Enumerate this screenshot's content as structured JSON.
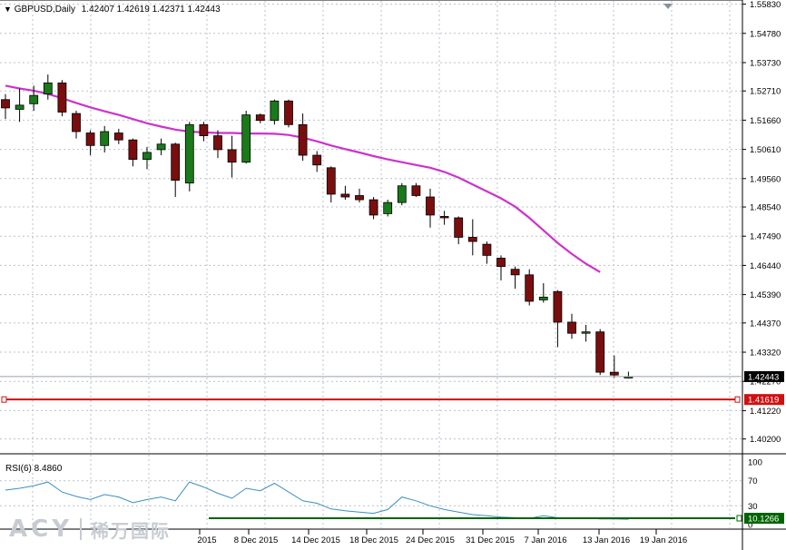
{
  "header": {
    "symbol": "GBPUSD,Daily",
    "ohlc": "1.42407 1.42619 1.42371 1.42443"
  },
  "price_axis": {
    "labels": [
      "1.55830",
      "1.54780",
      "1.53730",
      "1.52710",
      "1.51660",
      "1.50610",
      "1.49560",
      "1.48540",
      "1.47490",
      "1.46440",
      "1.45390",
      "1.44370",
      "1.43320",
      "1.42270",
      "1.41220",
      "1.40200"
    ],
    "bid_label": "1.42443",
    "level_label": "1.41619"
  },
  "date_axis": {
    "labels": [
      "2015",
      "8 Dec 2015",
      "14 Dec 2015",
      "18 Dec 2015",
      "24 Dec 2015",
      "31 Dec 2015",
      "7 Jan 2016",
      "13 Jan 2016",
      "19 Jan 2016"
    ]
  },
  "rsi": {
    "title": "RSI(6) 8.4860",
    "levels": [
      "100",
      "70",
      "30",
      "0"
    ],
    "value_label": "10.1266"
  },
  "watermark": {
    "brand": "ACY",
    "chinese": "稀万国际"
  },
  "colors": {
    "bull": "#1a7a1a",
    "bear": "#7a0e0e",
    "ma": "#cc33cc",
    "rsi_line": "#3a8fc0",
    "level_line": "#d01010",
    "rsi_value_line": "#006400",
    "grid": "#b8c0cc"
  },
  "chart_data": {
    "type": "candlestick",
    "symbol": "GBPUSD",
    "timeframe": "Daily",
    "price_range": [
      1.397,
      1.5598
    ],
    "horizontal_level": 1.41619,
    "current_price": 1.42443,
    "candles": [
      {
        "o": 1.524,
        "h": 1.526,
        "l": 1.517,
        "c": 1.521
      },
      {
        "o": 1.5205,
        "h": 1.528,
        "l": 1.516,
        "c": 1.522
      },
      {
        "o": 1.5225,
        "h": 1.529,
        "l": 1.52,
        "c": 1.5255
      },
      {
        "o": 1.526,
        "h": 1.533,
        "l": 1.524,
        "c": 1.53
      },
      {
        "o": 1.53,
        "h": 1.531,
        "l": 1.518,
        "c": 1.5195
      },
      {
        "o": 1.519,
        "h": 1.52,
        "l": 1.51,
        "c": 1.5125
      },
      {
        "o": 1.512,
        "h": 1.513,
        "l": 1.504,
        "c": 1.5075
      },
      {
        "o": 1.5075,
        "h": 1.5145,
        "l": 1.505,
        "c": 1.5125
      },
      {
        "o": 1.512,
        "h": 1.5135,
        "l": 1.508,
        "c": 1.5095
      },
      {
        "o": 1.5095,
        "h": 1.51,
        "l": 1.5,
        "c": 1.5025
      },
      {
        "o": 1.5025,
        "h": 1.507,
        "l": 1.499,
        "c": 1.505
      },
      {
        "o": 1.506,
        "h": 1.51,
        "l": 1.504,
        "c": 1.508
      },
      {
        "o": 1.508,
        "h": 1.5085,
        "l": 1.489,
        "c": 1.495
      },
      {
        "o": 1.494,
        "h": 1.516,
        "l": 1.491,
        "c": 1.515
      },
      {
        "o": 1.515,
        "h": 1.516,
        "l": 1.509,
        "c": 1.511
      },
      {
        "o": 1.511,
        "h": 1.513,
        "l": 1.503,
        "c": 1.506
      },
      {
        "o": 1.506,
        "h": 1.511,
        "l": 1.496,
        "c": 1.5015
      },
      {
        "o": 1.5015,
        "h": 1.52,
        "l": 1.501,
        "c": 1.5185
      },
      {
        "o": 1.5185,
        "h": 1.519,
        "l": 1.5155,
        "c": 1.5165
      },
      {
        "o": 1.5165,
        "h": 1.524,
        "l": 1.515,
        "c": 1.5235
      },
      {
        "o": 1.5235,
        "h": 1.524,
        "l": 1.514,
        "c": 1.515
      },
      {
        "o": 1.515,
        "h": 1.519,
        "l": 1.502,
        "c": 1.504
      },
      {
        "o": 1.504,
        "h": 1.5055,
        "l": 1.498,
        "c": 1.5005
      },
      {
        "o": 1.4995,
        "h": 1.5,
        "l": 1.487,
        "c": 1.49
      },
      {
        "o": 1.49,
        "h": 1.493,
        "l": 1.488,
        "c": 1.489
      },
      {
        "o": 1.4895,
        "h": 1.492,
        "l": 1.487,
        "c": 1.488
      },
      {
        "o": 1.488,
        "h": 1.489,
        "l": 1.481,
        "c": 1.4825
      },
      {
        "o": 1.483,
        "h": 1.488,
        "l": 1.482,
        "c": 1.487
      },
      {
        "o": 1.487,
        "h": 1.494,
        "l": 1.486,
        "c": 1.493
      },
      {
        "o": 1.493,
        "h": 1.494,
        "l": 1.489,
        "c": 1.4895
      },
      {
        "o": 1.489,
        "h": 1.492,
        "l": 1.478,
        "c": 1.4825
      },
      {
        "o": 1.482,
        "h": 1.484,
        "l": 1.479,
        "c": 1.4815
      },
      {
        "o": 1.4815,
        "h": 1.482,
        "l": 1.472,
        "c": 1.4745
      },
      {
        "o": 1.4745,
        "h": 1.481,
        "l": 1.468,
        "c": 1.473
      },
      {
        "o": 1.472,
        "h": 1.473,
        "l": 1.465,
        "c": 1.468
      },
      {
        "o": 1.467,
        "h": 1.468,
        "l": 1.459,
        "c": 1.464
      },
      {
        "o": 1.463,
        "h": 1.464,
        "l": 1.456,
        "c": 1.461
      },
      {
        "o": 1.461,
        "h": 1.463,
        "l": 1.45,
        "c": 1.4515
      },
      {
        "o": 1.452,
        "h": 1.458,
        "l": 1.451,
        "c": 1.453
      },
      {
        "o": 1.455,
        "h": 1.4555,
        "l": 1.435,
        "c": 1.444
      },
      {
        "o": 1.444,
        "h": 1.447,
        "l": 1.438,
        "c": 1.44
      },
      {
        "o": 1.44,
        "h": 1.443,
        "l": 1.437,
        "c": 1.4405
      },
      {
        "o": 1.4405,
        "h": 1.4415,
        "l": 1.425,
        "c": 1.426
      },
      {
        "o": 1.426,
        "h": 1.432,
        "l": 1.424,
        "c": 1.425
      },
      {
        "o": 1.4241,
        "h": 1.4262,
        "l": 1.4237,
        "c": 1.4244
      }
    ],
    "ma_series": [
      1.529,
      1.528,
      1.5272,
      1.526,
      1.5245,
      1.5228,
      1.5212,
      1.5198,
      1.5185,
      1.517,
      1.5155,
      1.5143,
      1.5132,
      1.5125,
      1.5122,
      1.512,
      1.512,
      1.5118,
      1.5118,
      1.5117,
      1.5113,
      1.5103,
      1.509,
      1.5075,
      1.5062,
      1.505,
      1.5037,
      1.5025,
      1.5015,
      1.5005,
      1.4995,
      1.498,
      1.496,
      1.4935,
      1.491,
      1.4885,
      1.4855,
      1.4815,
      1.477,
      1.4725,
      1.4685,
      1.465,
      1.462
    ],
    "rsi_range": [
      0,
      100
    ],
    "rsi_values": [
      55,
      58,
      62,
      68,
      52,
      45,
      40,
      48,
      44,
      35,
      40,
      44,
      38,
      68,
      60,
      50,
      42,
      58,
      54,
      66,
      52,
      38,
      34,
      25,
      22,
      20,
      18,
      24,
      44,
      38,
      30,
      24,
      20,
      16,
      14,
      12,
      11,
      10,
      14,
      11,
      10,
      11,
      9,
      9,
      8.5
    ]
  }
}
